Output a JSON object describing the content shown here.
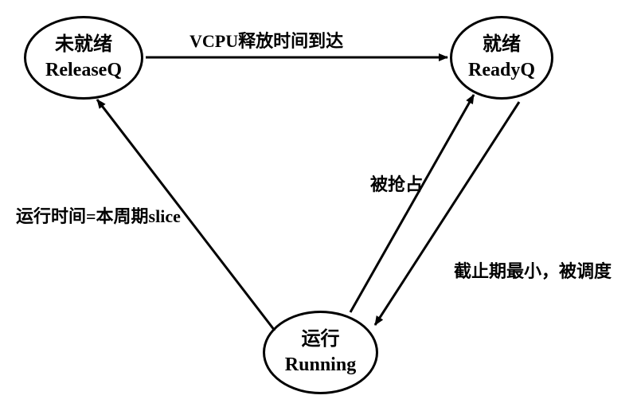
{
  "chart_data": {
    "type": "state-diagram",
    "title": "",
    "states": [
      {
        "id": "releaseq",
        "label_cn": "未就绪",
        "label_en": "ReleaseQ"
      },
      {
        "id": "readyq",
        "label_cn": "就绪",
        "label_en": "ReadyQ"
      },
      {
        "id": "running",
        "label_cn": "运行",
        "label_en": "Running"
      }
    ],
    "transitions": [
      {
        "from": "releaseq",
        "to": "readyq",
        "label": "VCPU释放时间到达"
      },
      {
        "from": "readyq",
        "to": "running",
        "label": "截止期最小，被调度"
      },
      {
        "from": "running",
        "to": "readyq",
        "label": "被抢占"
      },
      {
        "from": "running",
        "to": "releaseq",
        "label": "运行时间=本周期slice"
      }
    ]
  },
  "nodes": {
    "releaseq": {
      "line1": "未就绪",
      "line2": "ReleaseQ"
    },
    "readyq": {
      "line1": "就绪",
      "line2": "ReadyQ"
    },
    "running": {
      "line1": "运行",
      "line2": "Running"
    }
  },
  "edges": {
    "release_to_ready": "VCPU释放时间到达",
    "ready_to_running": "截止期最小，被调度",
    "running_to_ready": "被抢占",
    "running_to_release": "运行时间=本周期slice"
  }
}
